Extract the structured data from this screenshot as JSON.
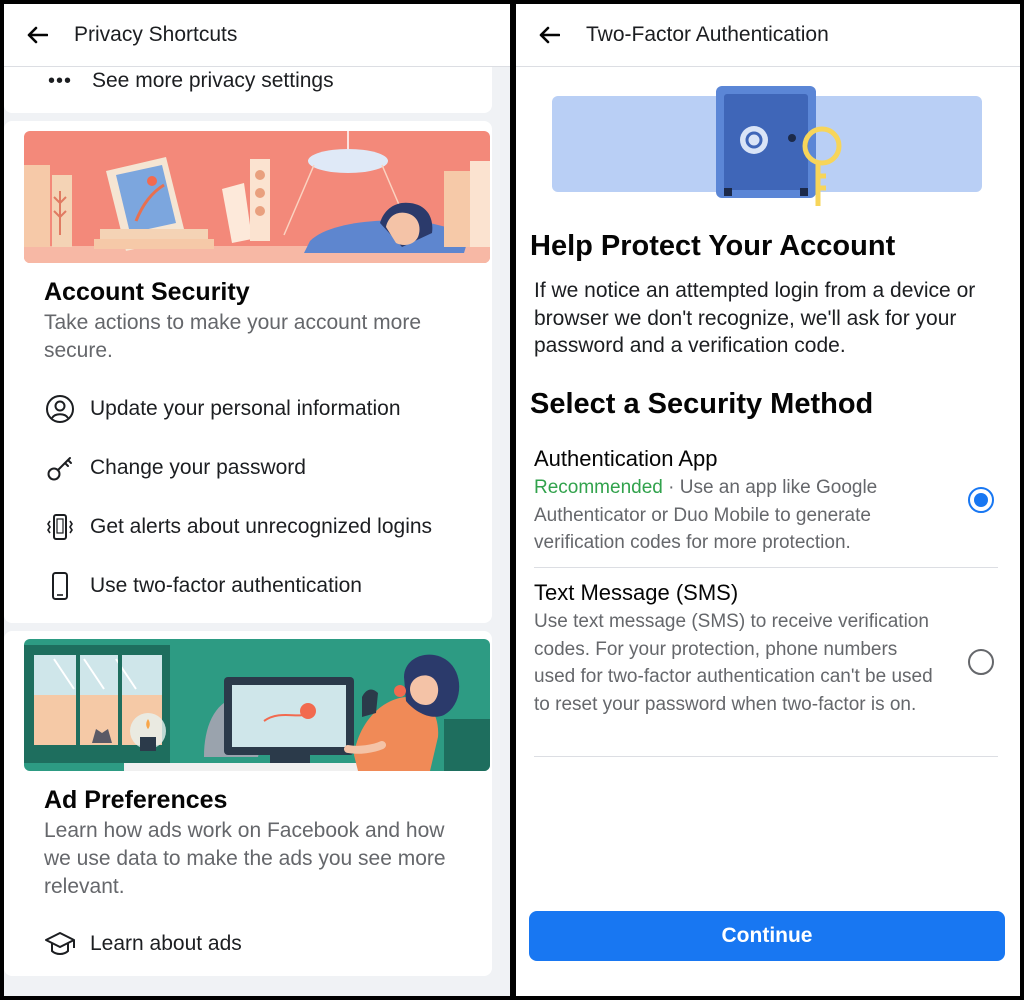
{
  "left": {
    "title": "Privacy Shortcuts",
    "see_more": "See more privacy settings",
    "account_security": {
      "title": "Account Security",
      "description": "Take actions to make your account more secure.",
      "items": [
        {
          "label": "Update your personal information",
          "icon": "person-circle-icon"
        },
        {
          "label": "Change your password",
          "icon": "key-icon"
        },
        {
          "label": "Get alerts about unrecognized logins",
          "icon": "vibrating-phone-icon"
        },
        {
          "label": "Use two-factor authentication",
          "icon": "phone-icon"
        }
      ]
    },
    "ad_preferences": {
      "title": "Ad Preferences",
      "description": "Learn how ads work on Facebook and how we use data to make the ads you see more relevant.",
      "item": {
        "label": "Learn about ads",
        "icon": "graduation-cap-icon"
      }
    }
  },
  "right": {
    "title": "Two-Factor Authentication",
    "heading": "Help Protect Your Account",
    "intro": "If we notice an attempted login from a device or browser we don't recognize, we'll ask for your password and a verification code.",
    "method_heading": "Select a Security Method",
    "options": [
      {
        "title": "Authentication App",
        "recommended": "Recommended",
        "description": " · Use an app like Google Authenticator or Duo Mobile to generate verification codes for more protection.",
        "selected": true
      },
      {
        "title": "Text Message (SMS)",
        "description": "Use text message (SMS) to receive verification codes. For your protection, phone numbers used for two-factor authentication can't be used to reset your password when two-factor is on.",
        "selected": false
      }
    ],
    "continue_label": "Continue"
  },
  "colors": {
    "brand_blue": "#1877f2",
    "recommended_green": "#31a24c",
    "secondary_text": "#65676b",
    "banner_salmon": "#f3897a",
    "banner_teal": "#2d9b83"
  }
}
